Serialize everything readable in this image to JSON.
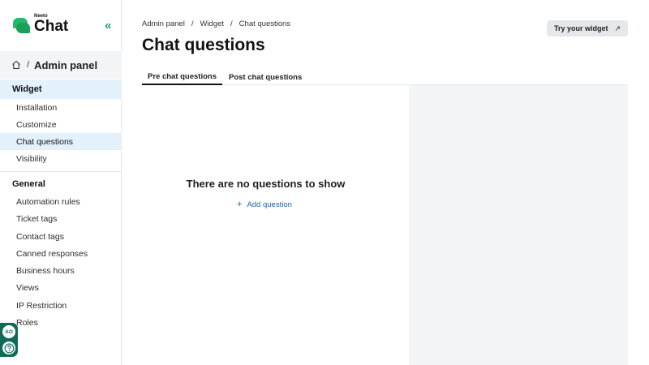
{
  "app": {
    "logo_small": "Neeto",
    "logo_big": "Chat"
  },
  "sidebar": {
    "admin_title": "Admin panel",
    "admin_separator": "/",
    "sections": [
      {
        "title": "Widget",
        "items": [
          "Installation",
          "Customize",
          "Chat questions",
          "Visibility"
        ]
      },
      {
        "title": "General",
        "items": [
          "Automation rules",
          "Ticket tags",
          "Contact tags",
          "Canned responses",
          "Business hours",
          "Views",
          "IP Restriction",
          "Roles"
        ]
      }
    ],
    "active_item": "Chat questions"
  },
  "user": {
    "initials": "AO"
  },
  "breadcrumb": {
    "items": [
      "Admin panel",
      "Widget",
      "Chat questions"
    ],
    "separator": "/"
  },
  "page": {
    "title": "Chat questions",
    "try_widget_label": "Try your widget",
    "tabs": [
      "Pre chat questions",
      "Post chat questions"
    ],
    "active_tab": "Pre chat questions",
    "empty_message": "There are no questions to show",
    "add_question_label": "Add question",
    "add_icon": "+",
    "external_icon": "↗"
  },
  "colors": {
    "brand": "#1fb96b",
    "active_bg": "#e3f1fd",
    "link": "#1a5fa8",
    "user_widget": "#0f6b58"
  }
}
